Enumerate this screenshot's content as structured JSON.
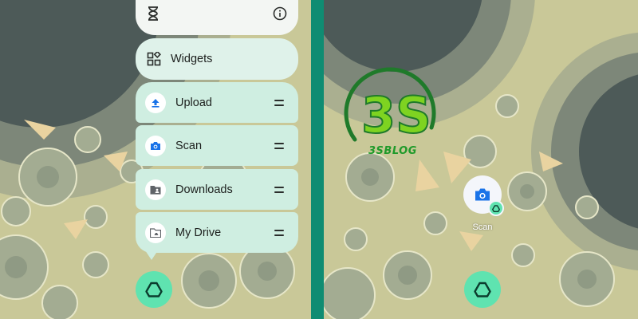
{
  "left_panel": {
    "menu": {
      "widgets_label": "Widgets",
      "items": [
        {
          "label": "Upload",
          "icon": "upload-icon"
        },
        {
          "label": "Scan",
          "icon": "camera-icon"
        },
        {
          "label": "Downloads",
          "icon": "folder-person-icon"
        },
        {
          "label": "My Drive",
          "icon": "folder-drive-icon"
        }
      ]
    },
    "app_icon": "google-drive-icon"
  },
  "right_panel": {
    "shortcut": {
      "label": "Scan",
      "icon": "camera-icon",
      "badge": "google-drive-icon"
    },
    "app_icon": "google-drive-icon",
    "watermark": {
      "logo_text": "3S",
      "subtitle": "3SBLOG"
    }
  },
  "colors": {
    "divider": "#0f8c72",
    "drive_button": "#5fe3b0",
    "menu_item": "#cfeee1",
    "menu_card": "#f3f6f3",
    "icon_blue": "#1a73e8",
    "watermark_green": "#1f9a2a"
  }
}
